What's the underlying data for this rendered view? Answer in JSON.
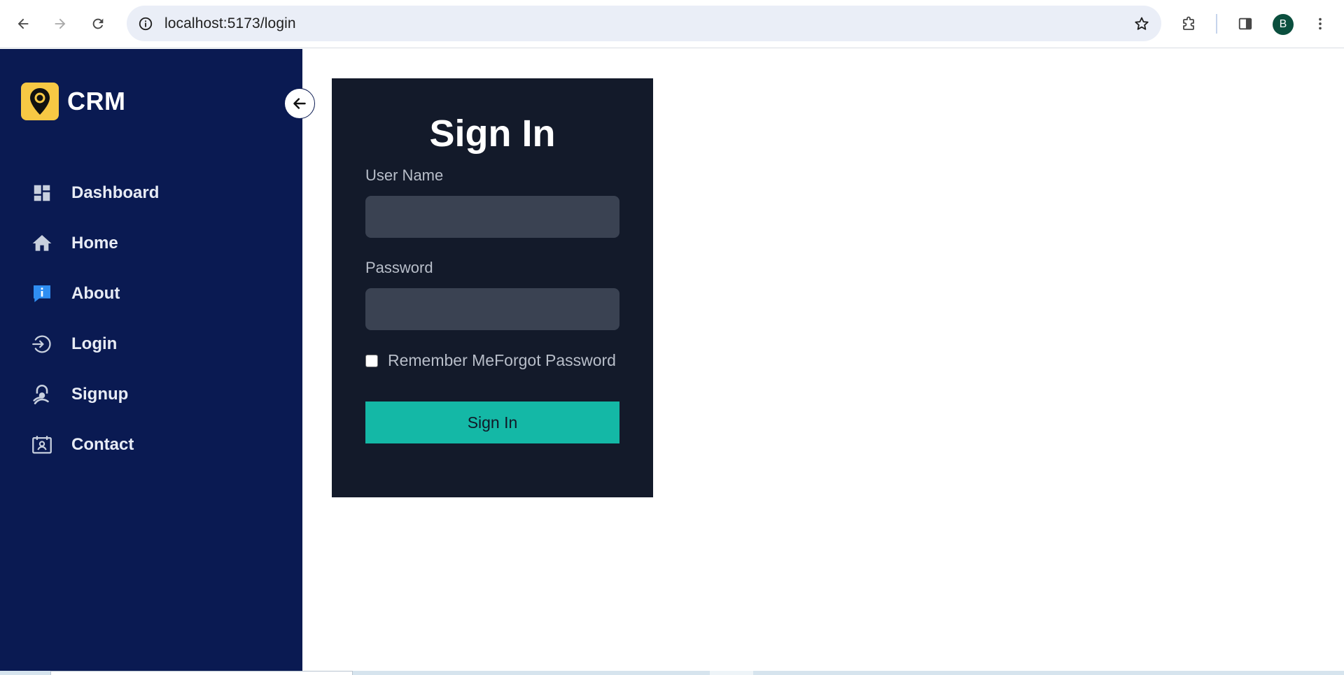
{
  "browser": {
    "url": "localhost:5173/login",
    "profile_initial": "B",
    "avatar_color": "#0b4f3e"
  },
  "sidebar": {
    "brand": "CRM",
    "background": "#0a1a52",
    "items": [
      {
        "label": "Dashboard",
        "icon": "dashboard-icon"
      },
      {
        "label": "Home",
        "icon": "home-icon"
      },
      {
        "label": "About",
        "icon": "info-icon"
      },
      {
        "label": "Login",
        "icon": "login-icon"
      },
      {
        "label": "Signup",
        "icon": "signup-icon"
      },
      {
        "label": "Contact",
        "icon": "contact-icon"
      }
    ]
  },
  "login_form": {
    "title": "Sign In",
    "username_label": "User Name",
    "username_value": "",
    "password_label": "Password",
    "password_value": "",
    "remember_checked": false,
    "remember_label": "Remember Me",
    "forgot_label": "Forgot Password",
    "submit_label": "Sign In",
    "accent": "#14b8a6",
    "card_background": "#131a2a"
  }
}
